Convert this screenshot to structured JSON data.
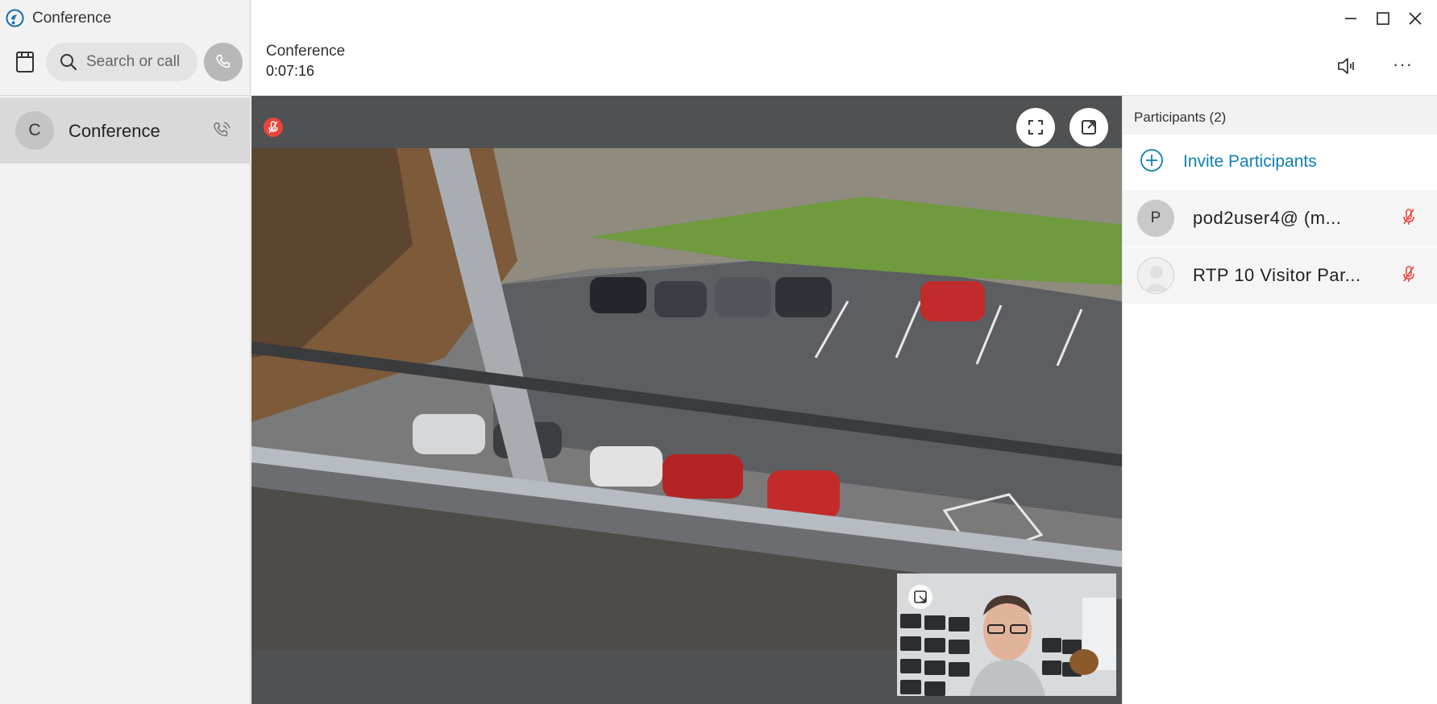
{
  "app": {
    "title": "Conference",
    "logo_icon": "app-logo-icon"
  },
  "sidebar": {
    "search_placeholder": "Search or call",
    "conversations": [
      {
        "initial": "C",
        "name": "Conference",
        "status_icon": "active-call-icon"
      }
    ]
  },
  "call": {
    "title": "Conference",
    "duration": "0:07:16"
  },
  "stage": {
    "muted_indicator": "mic-muted-icon",
    "buttons": [
      "fullscreen-icon",
      "popout-icon"
    ]
  },
  "participants": {
    "heading": "Participants (2)",
    "invite_label": "Invite Participants",
    "list": [
      {
        "initial": "P",
        "name": "pod2user4@ (m...",
        "muted": true
      },
      {
        "initial": "",
        "name": "RTP 10 Visitor Par...",
        "muted": true
      }
    ]
  },
  "colors": {
    "accent": "#0f7fb4",
    "muted_red": "#e8463b",
    "stage_bg": "#505153",
    "sidebar_bg": "#f2f2f2"
  }
}
